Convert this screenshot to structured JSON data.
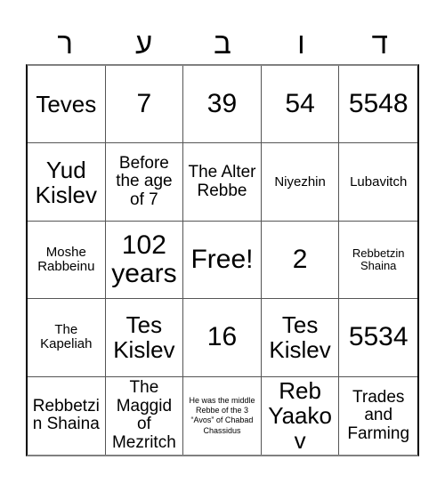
{
  "card": {
    "header": {
      "letters": [
        {
          "glyph": "ר",
          "name": "header-letter-reish"
        },
        {
          "glyph": "ע",
          "name": "header-letter-ayin"
        },
        {
          "glyph": "ב",
          "name": "header-letter-beis"
        },
        {
          "glyph": "ו",
          "name": "header-letter-vav"
        },
        {
          "glyph": "ד",
          "name": "header-letter-daled"
        }
      ]
    },
    "free_space_label": "Free!",
    "grid": {
      "rows": 5,
      "columns": 5,
      "cells": [
        {
          "text": "Teves",
          "size": "fs-lg"
        },
        {
          "text": "7",
          "size": "fs-xl"
        },
        {
          "text": "39",
          "size": "fs-xl"
        },
        {
          "text": "54",
          "size": "fs-xl"
        },
        {
          "text": "5548",
          "size": "fs-xl"
        },
        {
          "text": "Yud Kislev",
          "size": "fs-lg"
        },
        {
          "text": "Before the age of 7",
          "size": "fs-md"
        },
        {
          "text": "The Alter Rebbe",
          "size": "fs-md"
        },
        {
          "text": "Niyezhin",
          "size": "fs-sm"
        },
        {
          "text": "Lubavitch",
          "size": "fs-sm"
        },
        {
          "text": "Moshe Rabbeinu",
          "size": "fs-sm"
        },
        {
          "text": "102 years",
          "size": "fs-xl"
        },
        {
          "text": "Free!",
          "size": "fs-xl"
        },
        {
          "text": "2",
          "size": "fs-xl"
        },
        {
          "text": "Rebbetzin Shaina",
          "size": "fs-xs"
        },
        {
          "text": "The Kapeliah",
          "size": "fs-sm"
        },
        {
          "text": "Tes Kislev",
          "size": "fs-lg"
        },
        {
          "text": "16",
          "size": "fs-xl"
        },
        {
          "text": "Tes Kislev",
          "size": "fs-lg"
        },
        {
          "text": "5534",
          "size": "fs-xl"
        },
        {
          "text": "Rebbetzin Shaina",
          "size": "fs-md"
        },
        {
          "text": "The Maggid of Mezritch",
          "size": "fs-md"
        },
        {
          "text": "He was the middle Rebbe of the 3 “Avos” of Chabad Chassidus",
          "size": "fs-tiny"
        },
        {
          "text": "Reb Yaakov",
          "size": "fs-lg"
        },
        {
          "text": "Trades and Farming",
          "size": "fs-md"
        }
      ]
    }
  }
}
